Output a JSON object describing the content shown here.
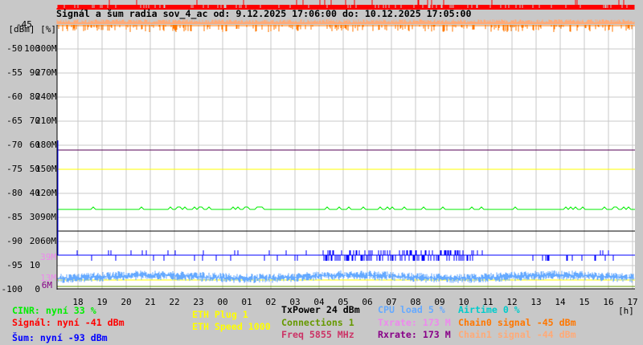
{
  "title": "Signál a šum radia sov_4_ac od: 9.12.2025 17:06:00 do: 10.12.2025 17:05:00",
  "y_axis": {
    "top_value": "-45",
    "units": "[dBm] [%]",
    "dbm": [
      "-50",
      "-55",
      "-60",
      "-65",
      "-70",
      "-75",
      "-80",
      "-85",
      "-90",
      "-95",
      "-100"
    ],
    "pct": [
      "100",
      "90",
      "80",
      "70",
      "60",
      "50",
      "40",
      "30",
      "20",
      "10",
      "0"
    ],
    "rate": [
      "300M",
      "270M",
      "240M",
      "210M",
      "180M",
      "150M",
      "120M",
      "90M",
      "60M",
      "",
      ""
    ],
    "extra_labels": {
      "txrate": "39M",
      "cpu": "13M",
      "rxrate": "6M"
    }
  },
  "x_axis": {
    "ticks": [
      "18",
      "19",
      "20",
      "21",
      "22",
      "23",
      "00",
      "01",
      "02",
      "03",
      "04",
      "05",
      "06",
      "07",
      "08",
      "09",
      "10",
      "11",
      "12",
      "13",
      "14",
      "15",
      "16",
      "17"
    ],
    "unit": "[h]"
  },
  "legend": {
    "cinr": "CINR: nyní 33 %",
    "signal": "Signál: nyní -41 dBm",
    "noise": "Šum: nyní -93 dBm",
    "eth_plug": "ETH Plug 1",
    "eth_speed": "ETH Speed 1000",
    "txpower": "TxPower 24 dBm",
    "connections": "Connections 1",
    "freq": "Freq 5855 MHz",
    "cpu": "CPU load 5 %",
    "txrate": "Txrate: 173 M",
    "rxrate": "Rxrate: 173 M",
    "airtime": "Airtime 0 %",
    "chain0": "Chain0 signal -45 dBm",
    "chain1": "Chain1 signal -44 dBm"
  },
  "colors": {
    "cinr": "#00ee00",
    "signal": "#ff0000",
    "noise": "#0000ff",
    "eth": "#ffff00",
    "txpower": "#000000",
    "connections": "#669900",
    "freq": "#cc3366",
    "cpu": "#66aaff",
    "txrate": "#ee88ee",
    "rxrate": "#880088",
    "airtime": "#00cccc",
    "chain0": "#ff7700",
    "chain1": "#ffaa77"
  },
  "chart_data": {
    "type": "line",
    "title": "Signál a šum radia sov_4_ac od: 9.12.2025 17:06:00 do: 10.12.2025 17:05:00",
    "xlabel": "[h]",
    "ylabel": "[dBm] [%]",
    "ylim": [
      -100,
      -45
    ],
    "series": [
      {
        "name": "Signál",
        "unit": "dBm",
        "approx_value": -41
      },
      {
        "name": "Chain0 signal",
        "unit": "dBm",
        "approx_value": -45
      },
      {
        "name": "Chain1 signal",
        "unit": "dBm",
        "approx_value": -44
      },
      {
        "name": "Šum",
        "unit": "dBm",
        "approx_value": -93
      },
      {
        "name": "CINR",
        "unit": "%",
        "approx_value": 33
      },
      {
        "name": "Txrate",
        "unit": "Mbps",
        "approx_value": 173
      },
      {
        "name": "Rxrate",
        "unit": "Mbps",
        "approx_value": 173
      },
      {
        "name": "ETH Speed",
        "unit": "Mbps",
        "value": 1000
      },
      {
        "name": "TxPower",
        "unit": "dBm",
        "value": 24
      },
      {
        "name": "CPU load",
        "unit": "%",
        "approx_value": 5
      },
      {
        "name": "Connections",
        "value": 1
      }
    ]
  }
}
